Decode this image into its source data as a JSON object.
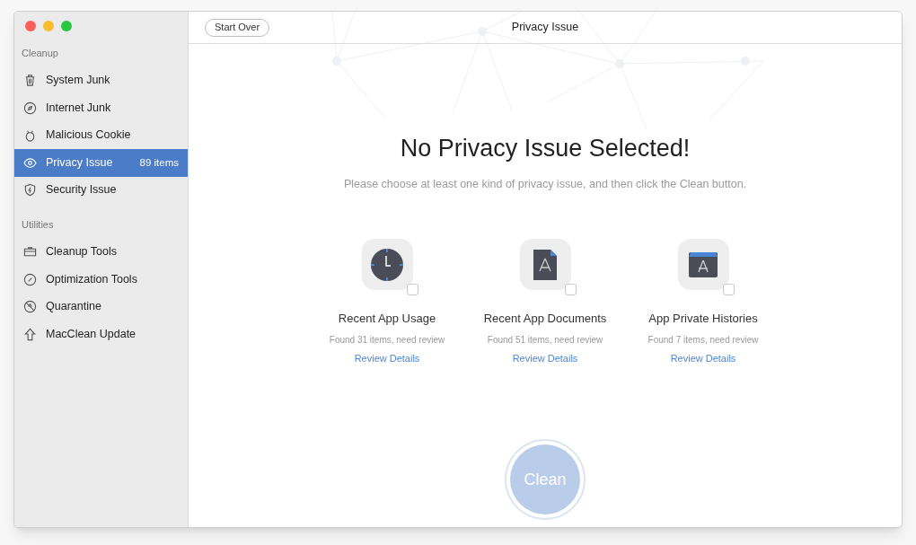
{
  "sidebar": {
    "sections": [
      {
        "heading": "Cleanup",
        "items": [
          {
            "label": "System Junk",
            "selected": false
          },
          {
            "label": "Internet Junk",
            "selected": false
          },
          {
            "label": "Malicious Cookie",
            "selected": false
          },
          {
            "label": "Privacy Issue",
            "selected": true,
            "badge": "89 items"
          },
          {
            "label": "Security Issue",
            "selected": false
          }
        ]
      },
      {
        "heading": "Utilities",
        "items": [
          {
            "label": "Cleanup Tools",
            "selected": false
          },
          {
            "label": "Optimization Tools",
            "selected": false
          },
          {
            "label": "Quarantine",
            "selected": false
          },
          {
            "label": "MacClean Update",
            "selected": false
          }
        ]
      }
    ]
  },
  "toolbar": {
    "start_over": "Start Over",
    "title": "Privacy Issue"
  },
  "main": {
    "heading": "No Privacy Issue Selected!",
    "subtitle": "Please choose at least one kind of privacy issue, and then click the Clean button.",
    "categories": [
      {
        "name": "Recent App Usage",
        "found": "Found 31 items, need review",
        "link": "Review Details",
        "checked": false
      },
      {
        "name": "Recent App Documents",
        "found": "Found 51 items, need review",
        "link": "Review Details",
        "checked": false
      },
      {
        "name": "App Private Histories",
        "found": "Found 7 items, need review",
        "link": "Review Details",
        "checked": false
      }
    ],
    "clean_button": {
      "label": "Clean",
      "disabled": true
    }
  }
}
